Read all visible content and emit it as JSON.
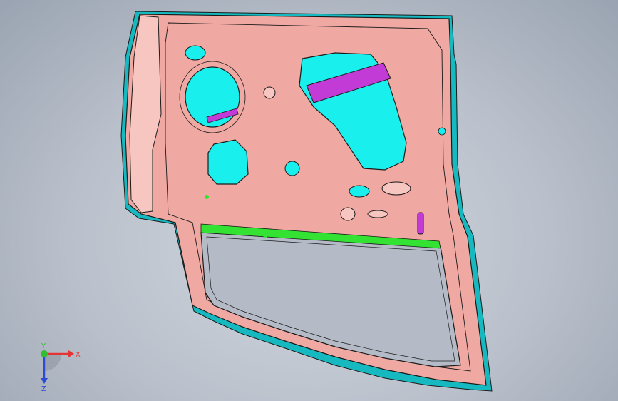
{
  "viewport": {
    "background_top": "#c6ccd5",
    "background_bottom": "#a1a9b6"
  },
  "model": {
    "part": "car-door-inner-panel",
    "colors": {
      "panel_fill": "#f0a9a2",
      "panel_light": "#f7c6c0",
      "outline": "#1a1a1a",
      "cyan_surface": "#19f0ee",
      "cyan_edge": "#17b9c0",
      "magenta_beam": "#c23bd6",
      "green_flange": "#33e233"
    }
  },
  "triad": {
    "x_label": "X",
    "y_label": "Y",
    "z_label": "Z",
    "x_color": "#e53333",
    "y_color": "#2fbf2f",
    "z_color": "#2f4bd6"
  }
}
